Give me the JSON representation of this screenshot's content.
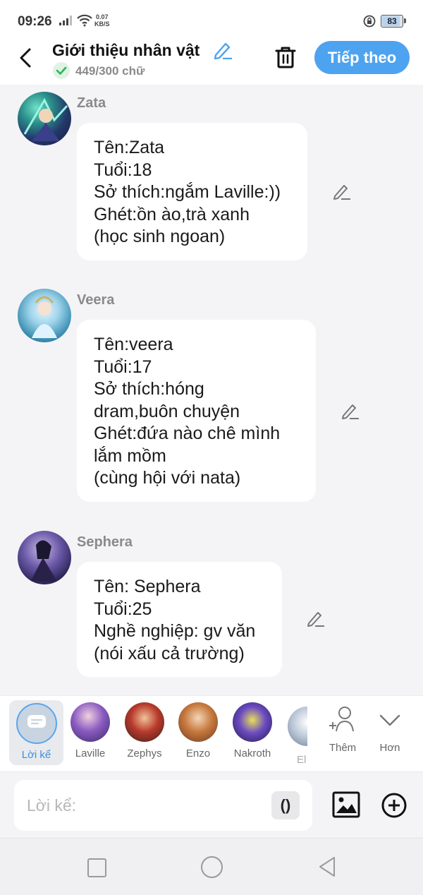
{
  "status": {
    "time": "09:26",
    "net_speed_value": "0.07",
    "net_speed_unit": "KB/S",
    "battery": "83",
    "battery_fraction": 0.83
  },
  "header": {
    "title": "Giới thiệu nhân vật",
    "char_count": "449/300 chữ",
    "next_label": "Tiếp theo"
  },
  "messages": [
    {
      "name": "Zata",
      "lines": [
        "Tên:Zata",
        "Tuổi:18",
        "Sở thích:ngắm Laville:))",
        "Ghét:ồn ào,trà xanh",
        "(học sinh ngoan)"
      ]
    },
    {
      "name": "Veera",
      "lines": [
        "Tên:veera",
        "Tuổi:17",
        "Sở thích:hóng",
        "dram,buôn chuyện",
        "Ghét:đứa nào chê mình",
        "lắm mồm",
        "(cùng hội với nata)"
      ]
    },
    {
      "name": "Sephera",
      "lines": [
        "Tên: Sephera",
        "Tuổi:25",
        "Nghề nghiệp: gv văn",
        "(nói xấu cả trường)"
      ]
    }
  ],
  "character_bar": {
    "narrator_label": "Lời kể",
    "characters": [
      {
        "label": "Laville"
      },
      {
        "label": "Zephys"
      },
      {
        "label": "Enzo"
      },
      {
        "label": "Nakroth"
      },
      {
        "label": "El"
      }
    ],
    "add_label": "Thêm",
    "more_label": "Hơn"
  },
  "input": {
    "placeholder": "Lời kể:",
    "paren_label": "()"
  },
  "colors": {
    "accent": "#4ea3f0",
    "background": "#f4f4f6",
    "bubble": "#ffffff"
  }
}
